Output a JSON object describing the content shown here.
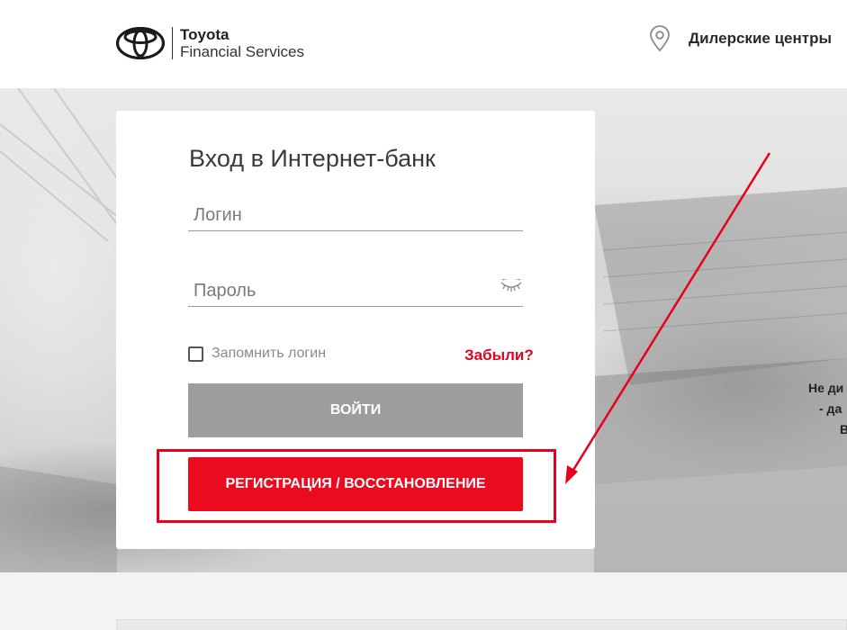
{
  "header": {
    "logo_brand": "Toyota",
    "logo_sub": "Financial Services",
    "dealers_label": "Дилерские центры"
  },
  "hero": {
    "side_text_lines": [
      "Не ди",
      "- да",
      "В"
    ]
  },
  "login": {
    "title": "Вход в Интернет-банк",
    "login_placeholder": "Логин",
    "password_placeholder": "Пароль",
    "remember_label": "Запомнить логин",
    "forgot_label": "Забыли?",
    "submit_label": "ВОЙТИ",
    "register_label": "РЕГИСТРАЦИЯ / ВОССТАНОВЛЕНИЕ"
  },
  "colors": {
    "accent_red": "#eb0a1e",
    "disabled_gray": "#9d9d9d",
    "annotation_red": "#e8001e"
  },
  "icons": {
    "logo": "toyota-emblem-icon",
    "location": "map-pin-icon",
    "password_toggle": "eye-closed-icon"
  }
}
